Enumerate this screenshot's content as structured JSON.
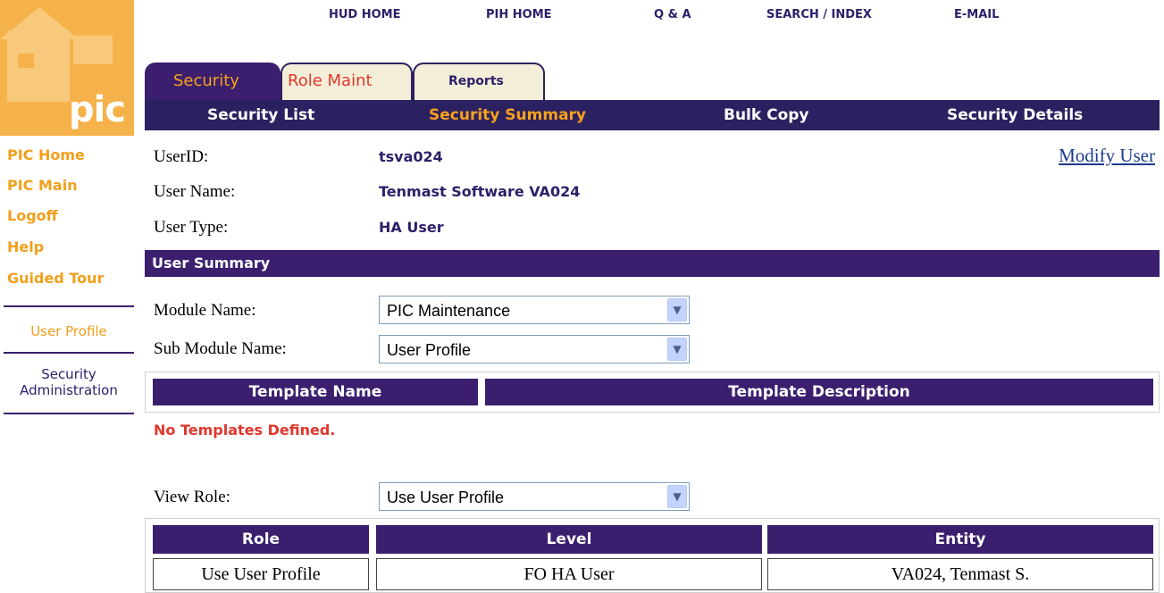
{
  "logo": {
    "text": "pic"
  },
  "top_nav": [
    "HUD HOME",
    "PIH HOME",
    "Q & A",
    "SEARCH / INDEX",
    "E-MAIL"
  ],
  "tabs": [
    {
      "label": "Security",
      "active": true
    },
    {
      "label": "Role Maint",
      "active": false
    },
    {
      "label": "Reports",
      "active": false
    }
  ],
  "sub_nav": [
    {
      "label": "Security List",
      "active": false
    },
    {
      "label": "Security Summary",
      "active": true
    },
    {
      "label": "Bulk Copy",
      "active": false
    },
    {
      "label": "Security Details",
      "active": false
    }
  ],
  "left_nav": {
    "links": [
      "PIC Home",
      "PIC Main",
      "Logoff",
      "Help",
      "Guided Tour"
    ],
    "sub_items": [
      {
        "label": "User Profile",
        "color": "#f29f1b"
      },
      {
        "label": "Security Administration",
        "color": "#2d1f6a"
      }
    ]
  },
  "user_info": {
    "userid_label": "UserID:",
    "userid_value": "tsva024",
    "name_label": "User Name:",
    "name_value": "Tenmast Software VA024",
    "type_label": "User Type:",
    "type_value": "HA User",
    "modify_link": "Modify User"
  },
  "summary": {
    "header": "User Summary",
    "module_label": "Module Name:",
    "module_value": "PIC Maintenance",
    "submodule_label": "Sub Module Name:",
    "submodule_value": "User Profile"
  },
  "templates": {
    "columns": [
      "Template Name",
      "Template Description"
    ],
    "empty_message": "No Templates Defined."
  },
  "roles": {
    "view_label": "View Role:",
    "view_value": "Use User Profile",
    "columns": [
      "Role",
      "Level",
      "Entity"
    ],
    "rows": [
      [
        "Use User Profile",
        "FO HA User",
        "VA024, Tenmast S."
      ]
    ]
  },
  "colors": {
    "brand_purple": "#2c2160",
    "accent_orange": "#f7a21b",
    "alert_red": "#e2362d"
  }
}
